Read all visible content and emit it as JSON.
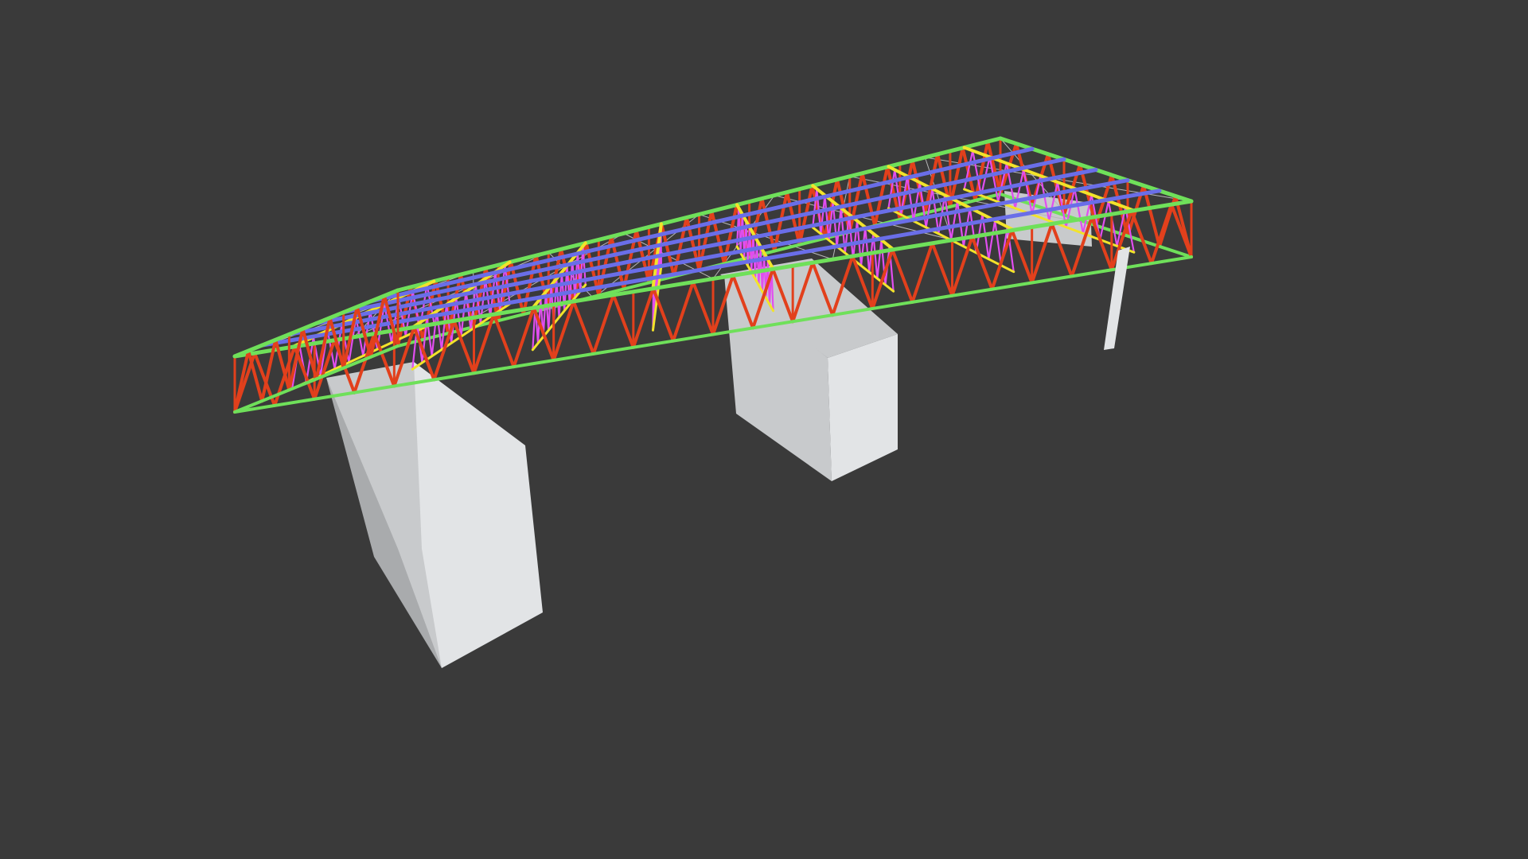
{
  "scene": {
    "background_color": "#3a3a3a",
    "subject": "steel-truss-roof-structure-on-concrete-supports",
    "colors": {
      "perimeter_chord": "#6fe05a",
      "perimeter_truss_web": "#e2401c",
      "longitudinal_purlin": "#6a6ee8",
      "cross_truss_chord": "#f2e32a",
      "cross_truss_web": "#e14ef0",
      "diagonal_bracing_tie": "#e0581e",
      "bracing_cable": "#b8b8b8",
      "concrete_face_light": "#e2e4e6",
      "concrete_face_mid": "#c8cacc",
      "concrete_face_dark": "#a9abad"
    },
    "elements": {
      "support_piers": 2,
      "steel_column": 1,
      "cross_trusses": 8,
      "longitudinal_purlins": 5
    }
  }
}
